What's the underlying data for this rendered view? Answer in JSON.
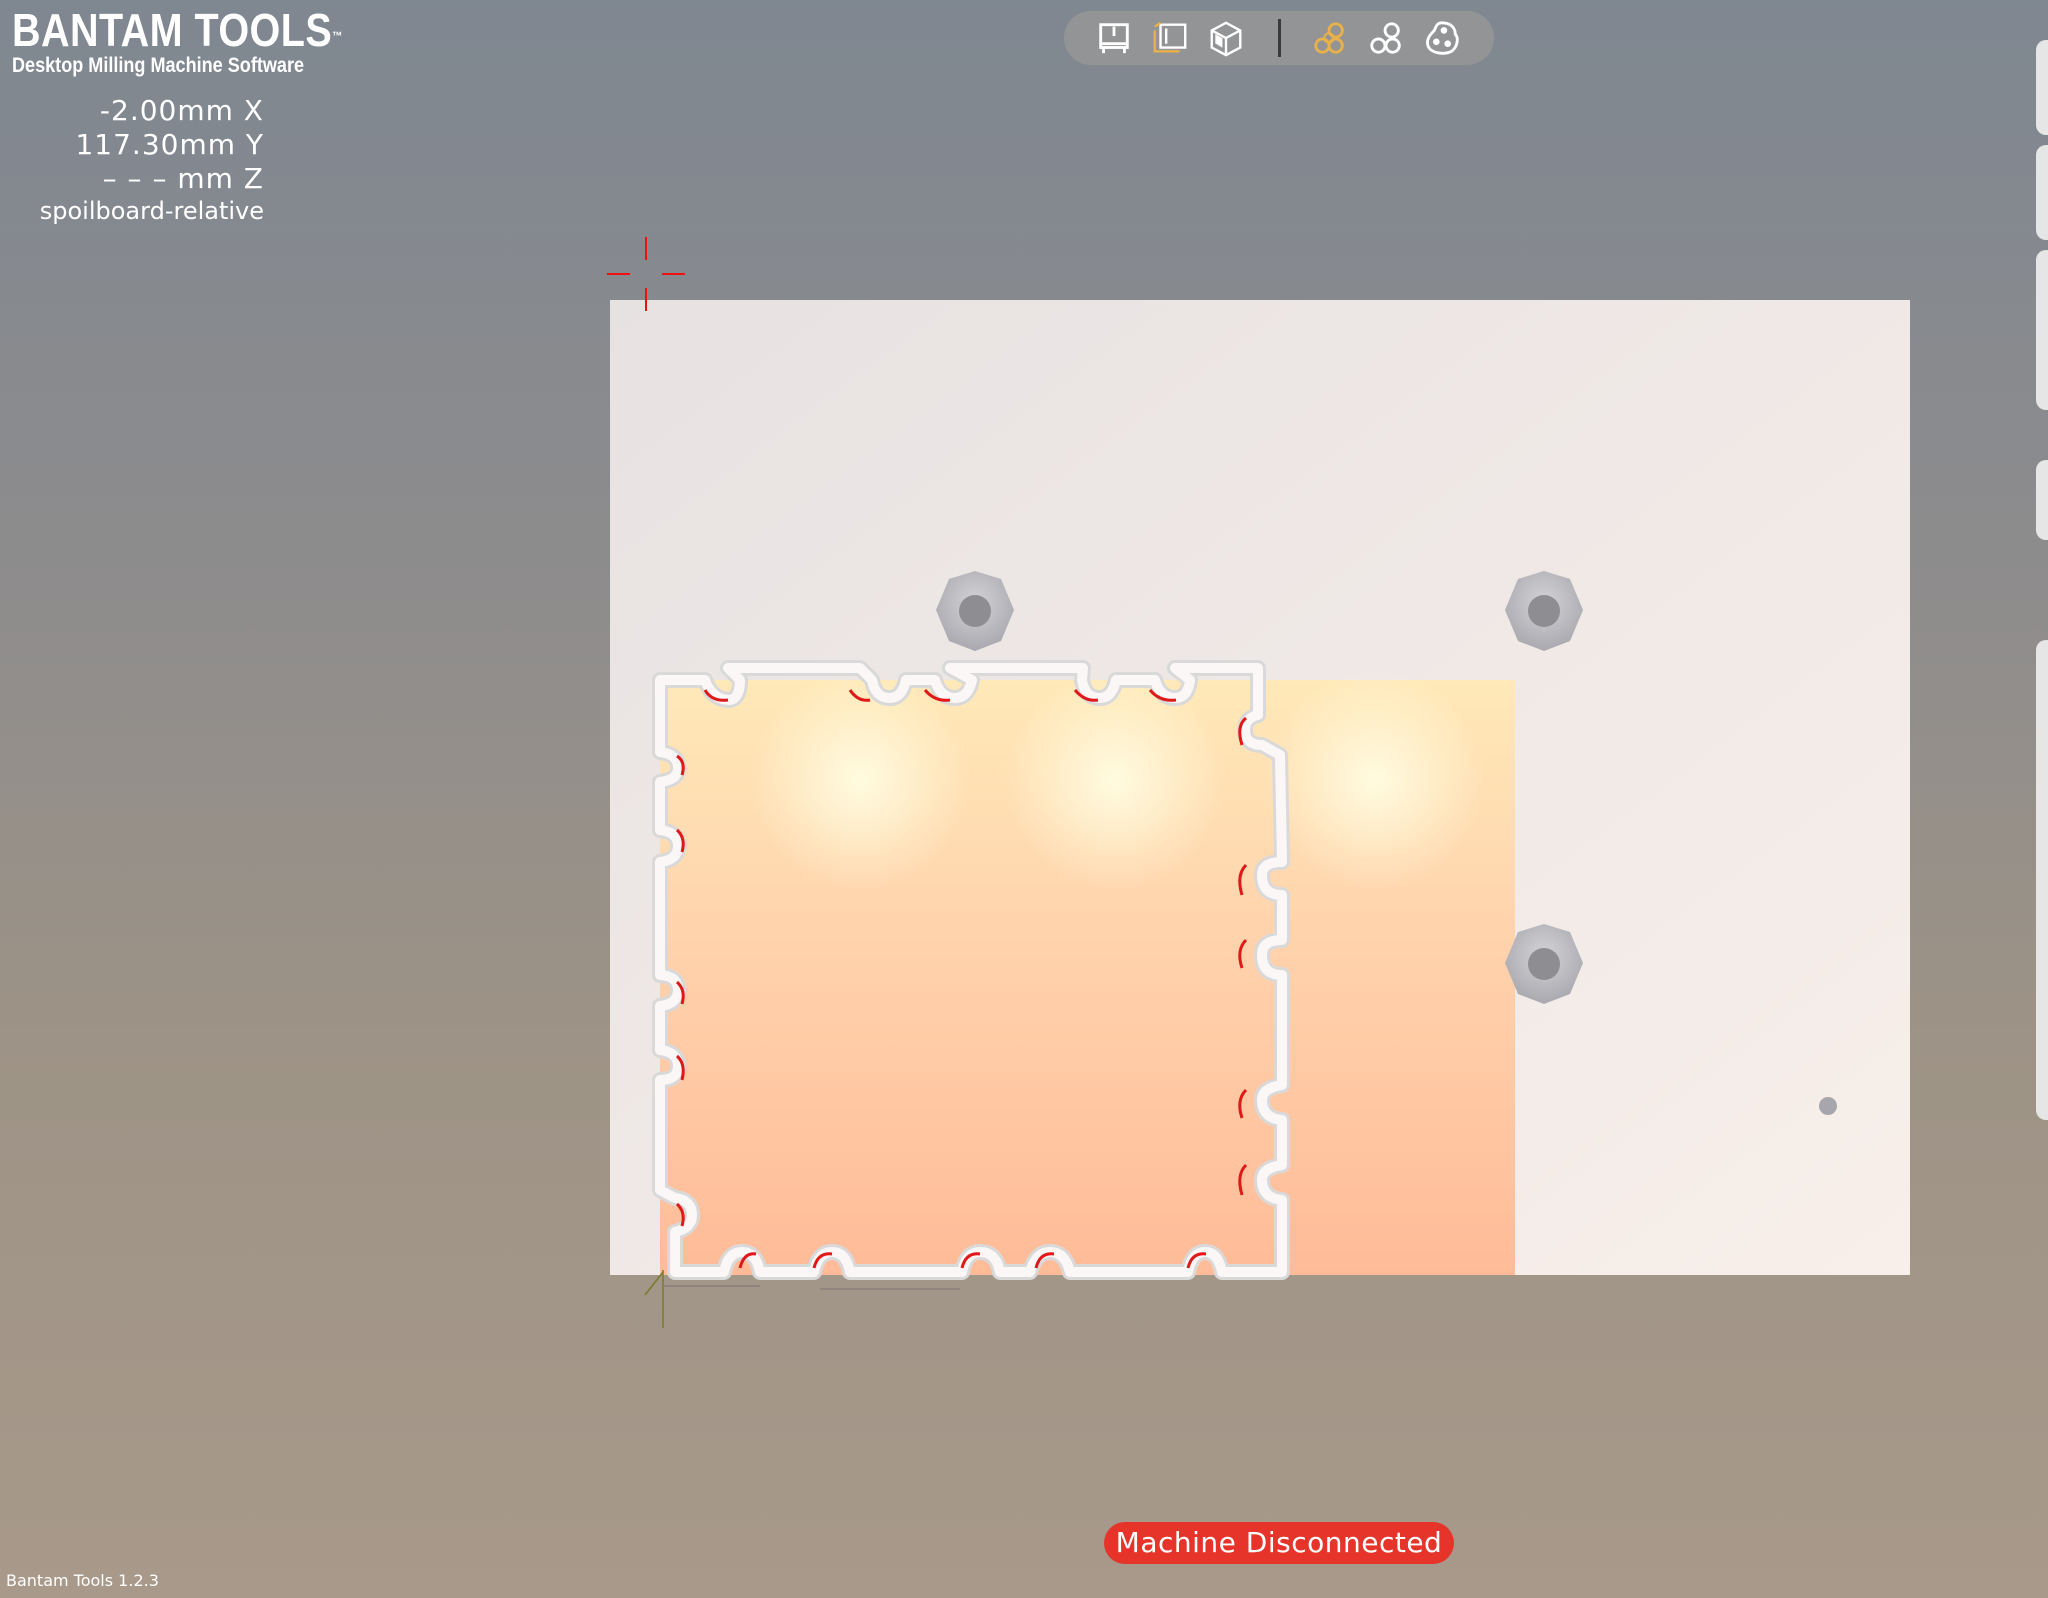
{
  "brand": {
    "title": "BANTAM TOOLS",
    "trademark": "™",
    "subtitle": "Desktop Milling Machine Software"
  },
  "position": {
    "x": "-2.00mm X",
    "y": "117.30mm Y",
    "z": "– – – mm Z",
    "reference": "spoilboard-relative"
  },
  "toolbar": {
    "view_buttons": [
      "view-top-icon",
      "view-front-icon",
      "view-iso-icon"
    ],
    "display_buttons": [
      "show-all-paths-icon",
      "show-outline-icon",
      "show-solid-icon"
    ],
    "active_color": "#e8b14a"
  },
  "status": {
    "label": "Machine Disconnected",
    "color": "#e6342b"
  },
  "footer": {
    "version": "Bantam Tools 1.2.3"
  }
}
